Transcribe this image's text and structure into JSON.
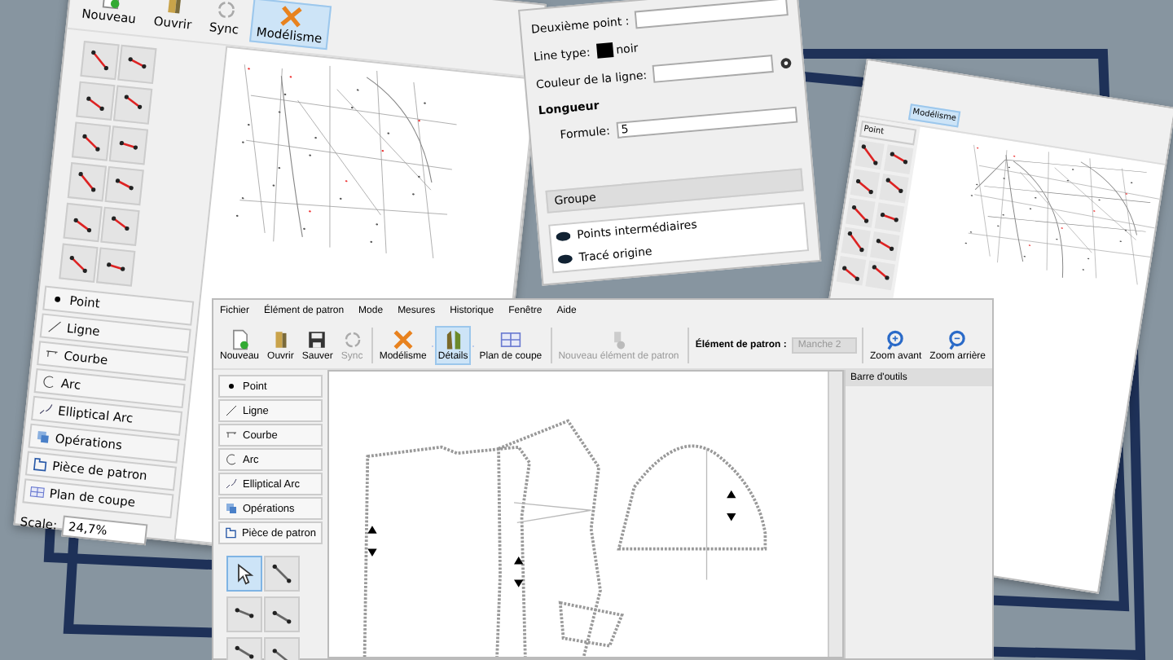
{
  "back_window": {
    "toolbar": [
      {
        "label": "Nouveau",
        "kind": "new",
        "selected": false
      },
      {
        "label": "Ouvrir",
        "kind": "open",
        "selected": false
      },
      {
        "label": "Sync",
        "kind": "sync",
        "selected": false
      },
      {
        "label": "Modélisme",
        "kind": "draft",
        "selected": true
      }
    ],
    "tools": [
      {
        "label": "Point",
        "kind": "point"
      },
      {
        "label": "Ligne",
        "kind": "line"
      },
      {
        "label": "Courbe",
        "kind": "curve"
      },
      {
        "label": "Arc",
        "kind": "arc"
      },
      {
        "label": "Elliptical Arc",
        "kind": "earc"
      },
      {
        "label": "Opérations",
        "kind": "ops"
      },
      {
        "label": "Pièce de patron",
        "kind": "piece"
      },
      {
        "label": "Plan de coupe",
        "kind": "layout"
      }
    ],
    "scale": {
      "label": "Scale:",
      "value": "24,7%"
    }
  },
  "properties_panel": {
    "rows": [
      {
        "label": "Deuxième point :",
        "kind": "combo"
      },
      {
        "label": "Line type:",
        "kind": "swatch",
        "value": "noir"
      },
      {
        "label": "Couleur de la ligne:",
        "kind": "field"
      }
    ],
    "section": "Longueur",
    "formula": {
      "label": "Formule:",
      "value": "5"
    },
    "group_title": "Groupe",
    "groups": [
      "Points intermédiaires",
      "Tracé origine"
    ]
  },
  "side_window": {
    "tool": "Point",
    "mode": "Modélisme"
  },
  "front_window": {
    "menu": [
      "Fichier",
      "Élément de patron",
      "Mode",
      "Mesures",
      "Historique",
      "Fenêtre",
      "Aide"
    ],
    "toolbar": [
      {
        "label": "Nouveau",
        "kind": "new",
        "selected": false,
        "disabled": false
      },
      {
        "label": "Ouvrir",
        "kind": "open",
        "selected": false,
        "disabled": false
      },
      {
        "label": "Sauver",
        "kind": "save",
        "selected": false,
        "disabled": false
      },
      {
        "label": "Sync",
        "kind": "sync",
        "selected": false,
        "disabled": true
      },
      {
        "label": "Modélisme",
        "kind": "draft",
        "selected": false,
        "disabled": false
      },
      {
        "label": "Détails",
        "kind": "details",
        "selected": true,
        "disabled": false
      },
      {
        "label": "Plan de coupe",
        "kind": "layout",
        "selected": false,
        "disabled": false
      },
      {
        "label": "Nouveau élément de patron",
        "kind": "newpiece",
        "selected": false,
        "disabled": true
      }
    ],
    "piece_selector": {
      "label": "Élément de patron :",
      "value": "Manche 2",
      "disabled": true
    },
    "zoom": [
      {
        "label": "Zoom avant",
        "kind": "in"
      },
      {
        "label": "Zoom arrière",
        "kind": "out"
      }
    ],
    "tools": [
      {
        "label": "Point",
        "kind": "point"
      },
      {
        "label": "Ligne",
        "kind": "line"
      },
      {
        "label": "Courbe",
        "kind": "curve"
      },
      {
        "label": "Arc",
        "kind": "arc"
      },
      {
        "label": "Elliptical Arc",
        "kind": "earc"
      },
      {
        "label": "Opérations",
        "kind": "ops"
      },
      {
        "label": "Pièce de patron",
        "kind": "piece"
      }
    ],
    "dock": {
      "title": "Barre d'outils"
    }
  }
}
